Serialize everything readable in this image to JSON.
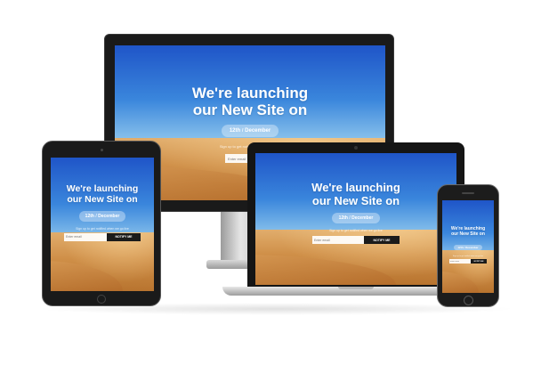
{
  "headline_line1": "We're launching",
  "headline_line2": "our New Site on",
  "date_day": "12th",
  "date_sep": "/",
  "date_month": "December",
  "subtext": "Sign up to get notified when we go live",
  "email_placeholder": "Enter email",
  "notify_label": "NOTIFY ME",
  "colors": {
    "sky_top": "#1f55c8",
    "sand": "#d9a565",
    "button": "#1b1b1b"
  }
}
